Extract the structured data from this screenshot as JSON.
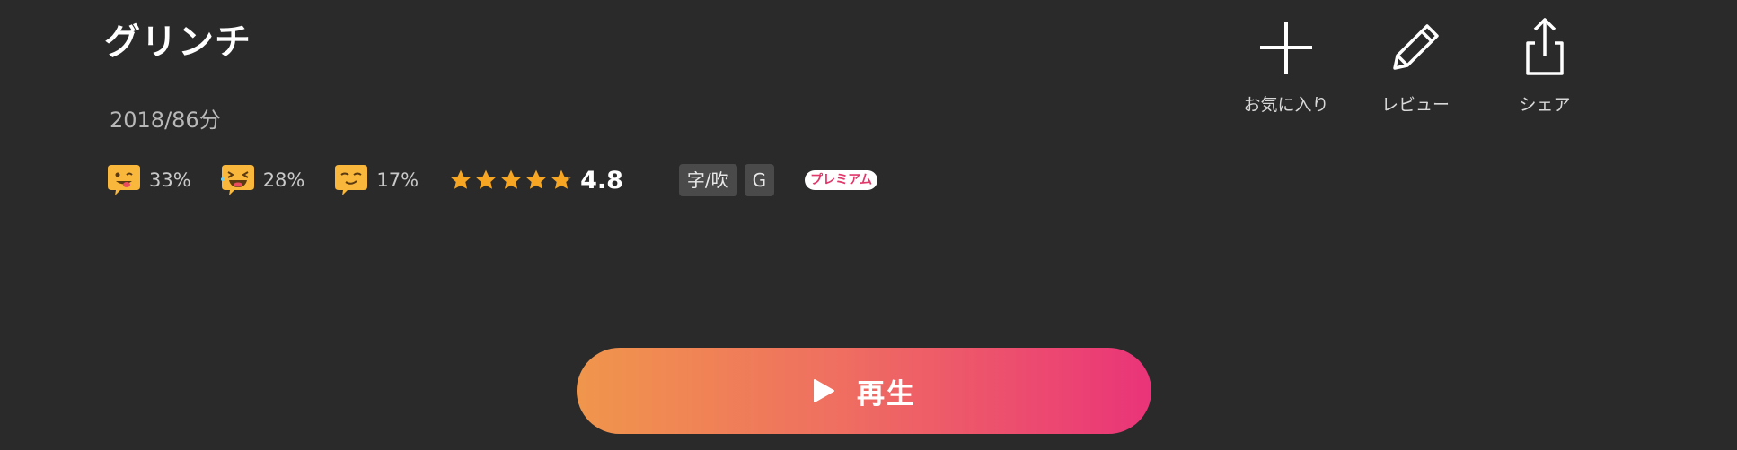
{
  "title": "グリンチ",
  "meta": "2018/86分",
  "reactions": [
    {
      "icon": "wink-tongue-emoji-icon",
      "pct": "33%"
    },
    {
      "icon": "laughing-emoji-icon",
      "pct": "28%"
    },
    {
      "icon": "smug-emoji-icon",
      "pct": "17%"
    }
  ],
  "rating": {
    "value": 4.8,
    "label": "4.8",
    "stars": 5
  },
  "badges": {
    "subtitle": "字/吹",
    "age": "G"
  },
  "premium": "プレミアム",
  "actions": {
    "favorite": "お気に入り",
    "review": "レビュー",
    "share": "シェア"
  },
  "play": {
    "label": "再生"
  },
  "colors": {
    "background": "#2a2a2a",
    "play_gradient_start": "#f0964c",
    "play_gradient_end": "#ea3479",
    "star": "#f6a623",
    "premium_text": "#e0386b"
  }
}
